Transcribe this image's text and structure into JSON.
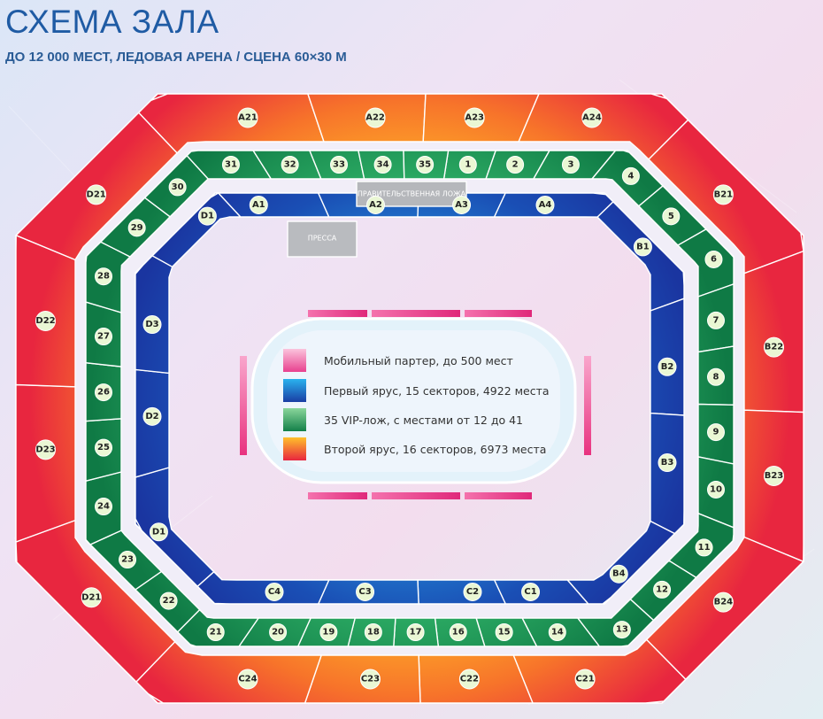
{
  "header": {
    "title": "СХЕМА ЗАЛА",
    "subtitle": "ДО 12 000 МЕСТ, ЛЕДОВАЯ АРЕНА / СЦЕНА 60×30 М"
  },
  "boxes": {
    "government": "ПРАВИТЕЛЬСТВЕННАЯ ЛОЖА",
    "press": "ПРЕССА"
  },
  "legend": [
    {
      "label": "Мобильный партер, до 500 мест",
      "color": "#e8418f"
    },
    {
      "label": "Первый ярус, 15 секторов, 4922 места",
      "color": "#1d5bc2"
    },
    {
      "label": "35 VIP-лож, с местами от 12 до 41",
      "color": "#1f9a52"
    },
    {
      "label": "Второй ярус, 16 секторов, 6973 места",
      "color": "#ef4a2e"
    }
  ],
  "sectors": {
    "outer": [
      "A21",
      "A22",
      "A23",
      "A24",
      "B21",
      "B22",
      "B23",
      "B24",
      "C21",
      "C22",
      "C23",
      "C24",
      "D21",
      "D23",
      "D22",
      "D21"
    ],
    "inner": [
      "A1",
      "A2",
      "A3",
      "A4",
      "B1",
      "B2",
      "B3",
      "B4",
      "C1",
      "C2",
      "C3",
      "C4",
      "D1",
      "D2",
      "D3",
      "D1"
    ],
    "vip": [
      "1",
      "2",
      "3",
      "4",
      "5",
      "6",
      "7",
      "8",
      "9",
      "10",
      "11",
      "12",
      "13",
      "14",
      "15",
      "16",
      "17",
      "18",
      "19",
      "20",
      "21",
      "22",
      "23",
      "24",
      "25",
      "26",
      "27",
      "28",
      "29",
      "30",
      "31",
      "32",
      "33",
      "34",
      "35"
    ]
  },
  "colors": {
    "outer_inner_edge": "#ffb627",
    "outer_outer_edge": "#ea2f3d",
    "inner_light": "#2aa7ea",
    "inner_dark": "#1a44a8",
    "vip_light": "#32b56a",
    "vip_dark": "#13804a",
    "badge": "#eaf7d4",
    "rink": "#e4f3fb"
  }
}
